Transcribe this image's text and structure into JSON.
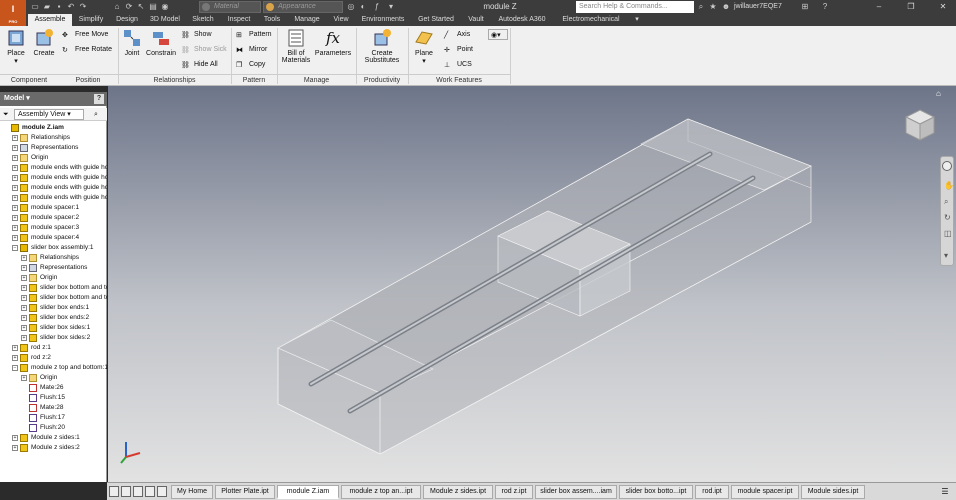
{
  "titlebar": {
    "app_button": "I",
    "app_button_sub": "PRO",
    "material_combo": "Material",
    "appearance_combo": "Appearance",
    "document_title": "module Z",
    "search_placeholder": "Search Help & Commands...",
    "user_name": "jwillauer7EQE7",
    "window_minimize": "–",
    "window_restore": "❐",
    "window_close": "✕",
    "help_button": "?",
    "star_button": "★",
    "cart_button": "⊞"
  },
  "tabs": [
    "Assemble",
    "Simplify",
    "Design",
    "3D Model",
    "Sketch",
    "Inspect",
    "Tools",
    "Manage",
    "View",
    "Environments",
    "Get Started",
    "Vault",
    "Autodesk A360",
    "Electromechanical"
  ],
  "active_tab": "Assemble",
  "ribbon": {
    "component": {
      "title": "Component",
      "place": "Place",
      "create": "Create"
    },
    "position": {
      "title": "Position",
      "free_move": "Free Move",
      "free_rotate": "Free Rotate"
    },
    "relationships": {
      "title": "Relationships",
      "joint": "Joint",
      "constrain": "Constrain",
      "show": "Show",
      "show_sick": "Show Sick",
      "hide_all": "Hide All"
    },
    "pattern": {
      "title": "Pattern",
      "pattern": "Pattern",
      "mirror": "Mirror",
      "copy": "Copy"
    },
    "manage": {
      "title": "Manage",
      "bom_line1": "Bill of",
      "bom_line2": "Materials",
      "parameters": "Parameters"
    },
    "productivity": {
      "title": "Productivity",
      "create_sub_line1": "Create",
      "create_sub_line2": "Substitutes"
    },
    "work_features": {
      "title": "Work Features",
      "plane": "Plane",
      "axis": "Axis",
      "point": "Point",
      "ucs": "UCS"
    }
  },
  "browser": {
    "title": "Model",
    "view_selector": "Assembly View",
    "tree": [
      {
        "label": "module Z.iam",
        "level": 0,
        "icon": "assembly-icon",
        "exp": ""
      },
      {
        "label": "Relationships",
        "level": 1,
        "icon": "folder-icon",
        "exp": "+"
      },
      {
        "label": "Representations",
        "level": 1,
        "icon": "representations-icon",
        "exp": "+"
      },
      {
        "label": "Origin",
        "level": 1,
        "icon": "folder-icon",
        "exp": "+"
      },
      {
        "label": "module ends with guide hole",
        "level": 1,
        "icon": "part-icon",
        "exp": "+"
      },
      {
        "label": "module ends with guide hole",
        "level": 1,
        "icon": "part-icon",
        "exp": "+"
      },
      {
        "label": "module ends with guide hole",
        "level": 1,
        "icon": "part-icon",
        "exp": "+"
      },
      {
        "label": "module ends with guide hole",
        "level": 1,
        "icon": "part-icon",
        "exp": "+"
      },
      {
        "label": "module spacer:1",
        "level": 1,
        "icon": "part-icon",
        "exp": "+"
      },
      {
        "label": "module spacer:2",
        "level": 1,
        "icon": "part-icon",
        "exp": "+"
      },
      {
        "label": "module spacer:3",
        "level": 1,
        "icon": "part-icon",
        "exp": "+"
      },
      {
        "label": "module spacer:4",
        "level": 1,
        "icon": "part-icon",
        "exp": "+"
      },
      {
        "label": "slider box assembly:1",
        "level": 1,
        "icon": "assembly-icon",
        "exp": "−"
      },
      {
        "label": "Relationships",
        "level": 2,
        "icon": "folder-icon",
        "exp": "+"
      },
      {
        "label": "Representations",
        "level": 2,
        "icon": "representations-icon",
        "exp": "+"
      },
      {
        "label": "Origin",
        "level": 2,
        "icon": "folder-icon",
        "exp": "+"
      },
      {
        "label": "slider box bottom and top",
        "level": 2,
        "icon": "part-icon",
        "exp": "+"
      },
      {
        "label": "slider box bottom and top",
        "level": 2,
        "icon": "part-icon",
        "exp": "+"
      },
      {
        "label": "slider box ends:1",
        "level": 2,
        "icon": "part-icon",
        "exp": "+"
      },
      {
        "label": "slider box ends:2",
        "level": 2,
        "icon": "part-icon",
        "exp": "+"
      },
      {
        "label": "slider box sides:1",
        "level": 2,
        "icon": "part-icon",
        "exp": "+"
      },
      {
        "label": "slider box sides:2",
        "level": 2,
        "icon": "part-icon",
        "exp": "+"
      },
      {
        "label": "rod z:1",
        "level": 1,
        "icon": "part-icon",
        "exp": "+"
      },
      {
        "label": "rod z:2",
        "level": 1,
        "icon": "part-icon",
        "exp": "+"
      },
      {
        "label": "module z top and bottom:1",
        "level": 1,
        "icon": "part-icon",
        "exp": "−"
      },
      {
        "label": "Origin",
        "level": 2,
        "icon": "folder-icon",
        "exp": "+"
      },
      {
        "label": "Mate:26",
        "level": 2,
        "icon": "mate-icon",
        "exp": ""
      },
      {
        "label": "Flush:15",
        "level": 2,
        "icon": "flush-icon",
        "exp": ""
      },
      {
        "label": "Mate:28",
        "level": 2,
        "icon": "mate-icon",
        "exp": ""
      },
      {
        "label": "Flush:17",
        "level": 2,
        "icon": "flush-icon",
        "exp": ""
      },
      {
        "label": "Flush:20",
        "level": 2,
        "icon": "flush-icon",
        "exp": ""
      },
      {
        "label": "Module z sides:1",
        "level": 1,
        "icon": "part-icon",
        "exp": "+"
      },
      {
        "label": "Module z sides:2",
        "level": 1,
        "icon": "part-icon",
        "exp": "+"
      }
    ]
  },
  "viewcube": {
    "front": "FRONT",
    "right": "RIGHT"
  },
  "doc_tabs": [
    "My Home",
    "Plotter Plate.ipt",
    "module Z.iam",
    "module z top an...ipt",
    "Module z sides.ipt",
    "rod z.ipt",
    "slider box assem....iam",
    "slider box botto...ipt",
    "rod.ipt",
    "module spacer.ipt",
    "Module sides.ipt"
  ],
  "active_doc_tab": "module Z.iam",
  "colors": {
    "accent": "#c8551b",
    "ribbon_bg": "#f0f0f0",
    "titlebar_bg": "#3c3c3c",
    "part_icon": "#e6b800"
  }
}
